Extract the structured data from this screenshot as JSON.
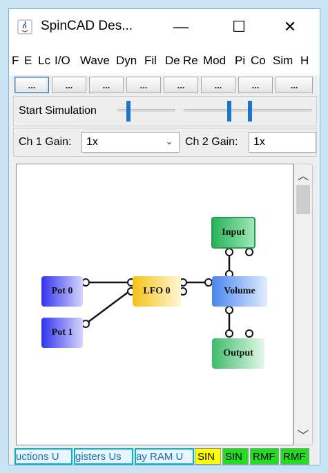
{
  "window": {
    "title": "SpinCAD Des...",
    "controls": {
      "minimize": "—",
      "maximize": "☐",
      "close": "✕"
    }
  },
  "menu": [
    "F",
    "E",
    "Lc",
    "I/O",
    "Wave",
    "Dyn",
    "Fil",
    "De",
    "Re",
    "Mod",
    "Pi",
    "Co",
    "Sim",
    "H"
  ],
  "toolbar": {
    "buttons": [
      "...",
      "...",
      "...",
      "...",
      "...",
      "...",
      "...",
      "..."
    ]
  },
  "simulation": {
    "start_label": "Start Simulation"
  },
  "gain": {
    "ch1_label": "Ch 1 Gain:",
    "ch1_value": "1x",
    "ch2_label": "Ch 2 Gain:",
    "ch2_value": "1x"
  },
  "blocks": {
    "pot0": "Pot 0",
    "pot1": "Pot 1",
    "lfo0": "LFO 0",
    "input": "Input",
    "volume": "Volume",
    "output": "Output"
  },
  "scrollbar": {
    "up": "︿",
    "down": "﹀"
  },
  "status": {
    "instructions": "uctions U",
    "registers": "gisters Us",
    "ram": "ay RAM U",
    "sin0": "SIN",
    "sin1": "SIN",
    "rmp0": "RMF",
    "rmp1": "RMF"
  },
  "colors": {
    "pot": "#3f3ff0",
    "lfo": "#f5d040",
    "volume": "#5a96f0",
    "io": "#3fbf6a",
    "status_yellow": "#ffff00",
    "status_green": "#22dd22",
    "status_cyan_border": "#00b4c8"
  }
}
